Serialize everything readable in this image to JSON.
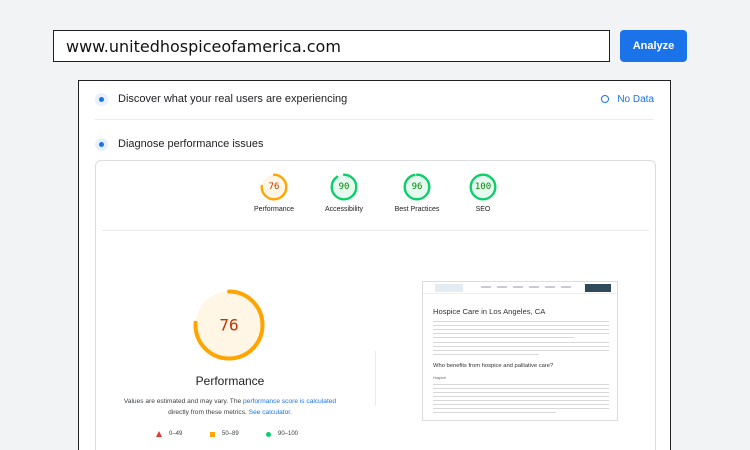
{
  "search": {
    "url": "www.unitedhospiceofamerica.com",
    "analyze_label": "Analyze"
  },
  "crux": {
    "title": "Discover what your real users are experiencing",
    "status": "No Data"
  },
  "diagnose": {
    "title": "Diagnose performance issues"
  },
  "scores": [
    {
      "label": "Performance",
      "value": 76,
      "color": "#ffa400"
    },
    {
      "label": "Accessibility",
      "value": 90,
      "color": "#0cce6b"
    },
    {
      "label": "Best Practices",
      "value": 96,
      "color": "#0cce6b"
    },
    {
      "label": "SEO",
      "value": 100,
      "color": "#0cce6b"
    }
  ],
  "performance": {
    "score": 76,
    "title": "Performance",
    "note_prefix": "Values are estimated and may vary. The ",
    "note_link1": "performance score is calculated",
    "note_middle": " directly from these metrics. ",
    "note_link2": "See calculator.",
    "note_suffix": ""
  },
  "legend": [
    {
      "range": "0–49",
      "color": "#e53935",
      "shape": "triangle"
    },
    {
      "range": "50–89",
      "color": "#ffa400",
      "shape": "square"
    },
    {
      "range": "90–100",
      "color": "#0cce6b",
      "shape": "circle"
    }
  ],
  "screenshot": {
    "heading": "Hospice Care in Los Angeles, CA",
    "subheading": "Who benefits from hospice and palliative care?",
    "small_label": "Hospice"
  },
  "colors": {
    "accent": "#1a73e8",
    "average": "#ffa400",
    "pass": "#0cce6b",
    "fail": "#e53935"
  }
}
